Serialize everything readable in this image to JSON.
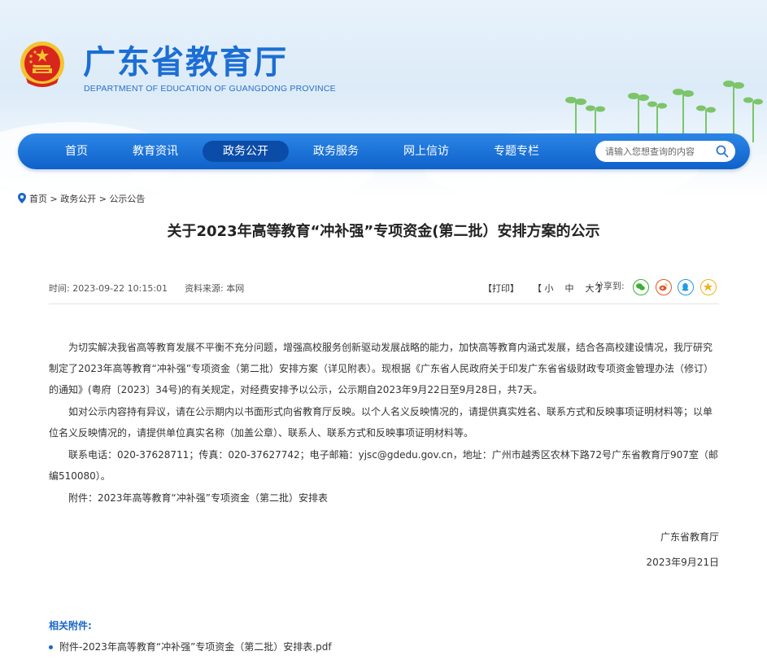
{
  "site": {
    "title": "广东省教育厅",
    "subtitle": "DEPARTMENT OF EDUCATION OF GUANGDONG PROVINCE"
  },
  "nav": {
    "items": [
      {
        "label": "首页"
      },
      {
        "label": "教育资讯"
      },
      {
        "label": "政务公开"
      },
      {
        "label": "政务服务"
      },
      {
        "label": "网上信访"
      },
      {
        "label": "专题专栏"
      }
    ],
    "search_placeholder": "请输入您想查询的内容"
  },
  "breadcrumb": [
    "首页",
    "政务公开",
    "公示公告"
  ],
  "breadcrumb_sep": " > ",
  "article": {
    "title": "关于2023年高等教育“冲补强”专项资金(第二批）安排方案的公示",
    "time_label": "时间:",
    "time": "2023-09-22 10:15:01",
    "source_label": "资料来源:",
    "source": "本网",
    "print": "【打印】",
    "font_open": "【",
    "font_small": "小",
    "font_medium": "中",
    "font_large": "大",
    "font_close": "】",
    "share_label": "分享到:",
    "paragraphs": [
      "为切实解决我省高等教育发展不平衡不充分问题，增强高校服务创新驱动发展战略的能力，加快高等教育内涵式发展，结合各高校建设情况，我厅研究制定了2023年高等教育“冲补强”专项资金（第二批）安排方案（详见附表）。现根据《广东省人民政府关于印发广东省省级财政专项资金管理办法（修订）的通知》(粤府〔2023〕34号)的有关规定，对经费安排予以公示，公示期自2023年9月22日至9月28日，共7天。",
      "如对公示内容持有异议，请在公示期内以书面形式向省教育厅反映。以个人名义反映情况的，请提供真实姓名、联系方式和反映事项证明材料等；以单位名义反映情况的，请提供单位真实名称（加盖公章）、联系人、联系方式和反映事项证明材料等。",
      "联系电话：020-37628711；传真：020-37627742；电子邮箱：yjsc@gdedu.gov.cn，地址：广州市越秀区农林下路72号广东省教育厅907室（邮编510080）。",
      "附件：2023年高等教育“冲补强”专项资金（第二批）安排表"
    ],
    "signature": "广东省教育厅",
    "date": "2023年9月21日"
  },
  "attachments": {
    "heading": "相关附件:",
    "items": [
      "附件-2023年高等教育“冲补强”专项资金（第二批）安排表.pdf"
    ]
  },
  "colors": {
    "brand_blue": "#1c6ed4",
    "nav_active": "#0b4ca8",
    "wechat": "#3cb034",
    "weibo": "#e8542a",
    "qq": "#1f9be6",
    "qzone": "#f0b21a"
  },
  "icons": {
    "emblem": "national-emblem-icon",
    "search": "search-icon",
    "location": "location-pin-icon",
    "share": [
      "wechat-icon",
      "weibo-icon",
      "qq-icon",
      "qzone-icon"
    ]
  }
}
